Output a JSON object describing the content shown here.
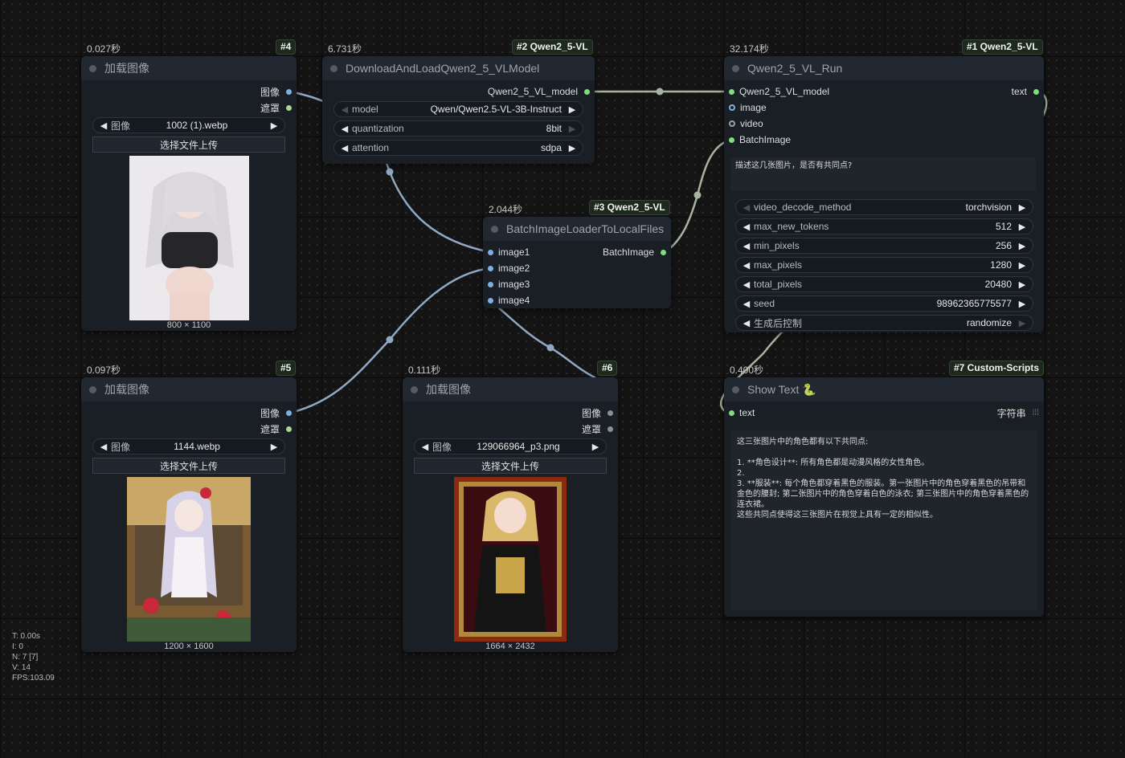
{
  "stats": {
    "t": "T: 0.00s",
    "i": "I: 0",
    "n": "N: 7 [7]",
    "v": "V: 14",
    "fps": "FPS:103.09"
  },
  "nodes": {
    "n4": {
      "timing": "0.027秒",
      "badge": "#4",
      "title": "加载图像",
      "out_image": "图像",
      "out_mask": "遮罩",
      "widget_label": "图像",
      "widget_value": "1002 (1).webp",
      "upload": "选择文件上传",
      "dims": "800 × 1100"
    },
    "n2": {
      "timing": "6.731秒",
      "badge": "#2 Qwen2_5-VL",
      "title": "DownloadAndLoadQwen2_5_VLModel",
      "out_model": "Qwen2_5_VL_model",
      "widgets": [
        {
          "label": "model",
          "value": "Qwen/Qwen2.5-VL-3B-Instruct"
        },
        {
          "label": "quantization",
          "value": "8bit"
        },
        {
          "label": "attention",
          "value": "sdpa"
        }
      ]
    },
    "n3": {
      "timing": "2.044秒",
      "badge": "#3 Qwen2_5-VL",
      "title": "BatchImageLoaderToLocalFiles",
      "inputs": [
        "image1",
        "image2",
        "image3",
        "image4"
      ],
      "out": "BatchImage"
    },
    "n1": {
      "timing": "32.174秒",
      "badge": "#1 Qwen2_5-VL",
      "title": "Qwen2_5_VL_Run",
      "inputs": [
        "Qwen2_5_VL_model",
        "image",
        "video",
        "BatchImage"
      ],
      "out": "text",
      "prompt": "描述这几张图片，是否有共同点?",
      "widgets": [
        {
          "label": "video_decode_method",
          "value": "torchvision"
        },
        {
          "label": "max_new_tokens",
          "value": "512"
        },
        {
          "label": "min_pixels",
          "value": "256"
        },
        {
          "label": "max_pixels",
          "value": "1280"
        },
        {
          "label": "total_pixels",
          "value": "20480"
        },
        {
          "label": "seed",
          "value": "98962365775577"
        },
        {
          "label": "生成后控制",
          "value": "randomize"
        }
      ]
    },
    "n5": {
      "timing": "0.097秒",
      "badge": "#5",
      "title": "加载图像",
      "out_image": "图像",
      "out_mask": "遮罩",
      "widget_label": "图像",
      "widget_value": "1144.webp",
      "upload": "选择文件上传",
      "dims": "1200 × 1600"
    },
    "n6": {
      "timing": "0.111秒",
      "badge": "#6",
      "title": "加载图像",
      "out_image": "图像",
      "out_mask": "遮罩",
      "widget_label": "图像",
      "widget_value": "129066964_p3.png",
      "upload": "选择文件上传",
      "dims": "1664 × 2432"
    },
    "n7": {
      "timing": "0.400秒",
      "badge": "#7 Custom-Scripts",
      "title": "Show Text",
      "emoji": "🐍",
      "input": "text",
      "type_label": "字符串",
      "text": "这三张图片中的角色都有以下共同点:\n\n1. **角色设计**: 所有角色都是动漫风格的女性角色。\n2.\n3. **服装**: 每个角色都穿着黑色的服装。第一张图片中的角色穿着黑色的吊带和金色的腰封; 第二张图片中的角色穿着白色的泳衣; 第三张图片中的角色穿着黑色的连衣裙。\n这些共同点使得这三张图片在视觉上具有一定的相似性。"
    }
  }
}
